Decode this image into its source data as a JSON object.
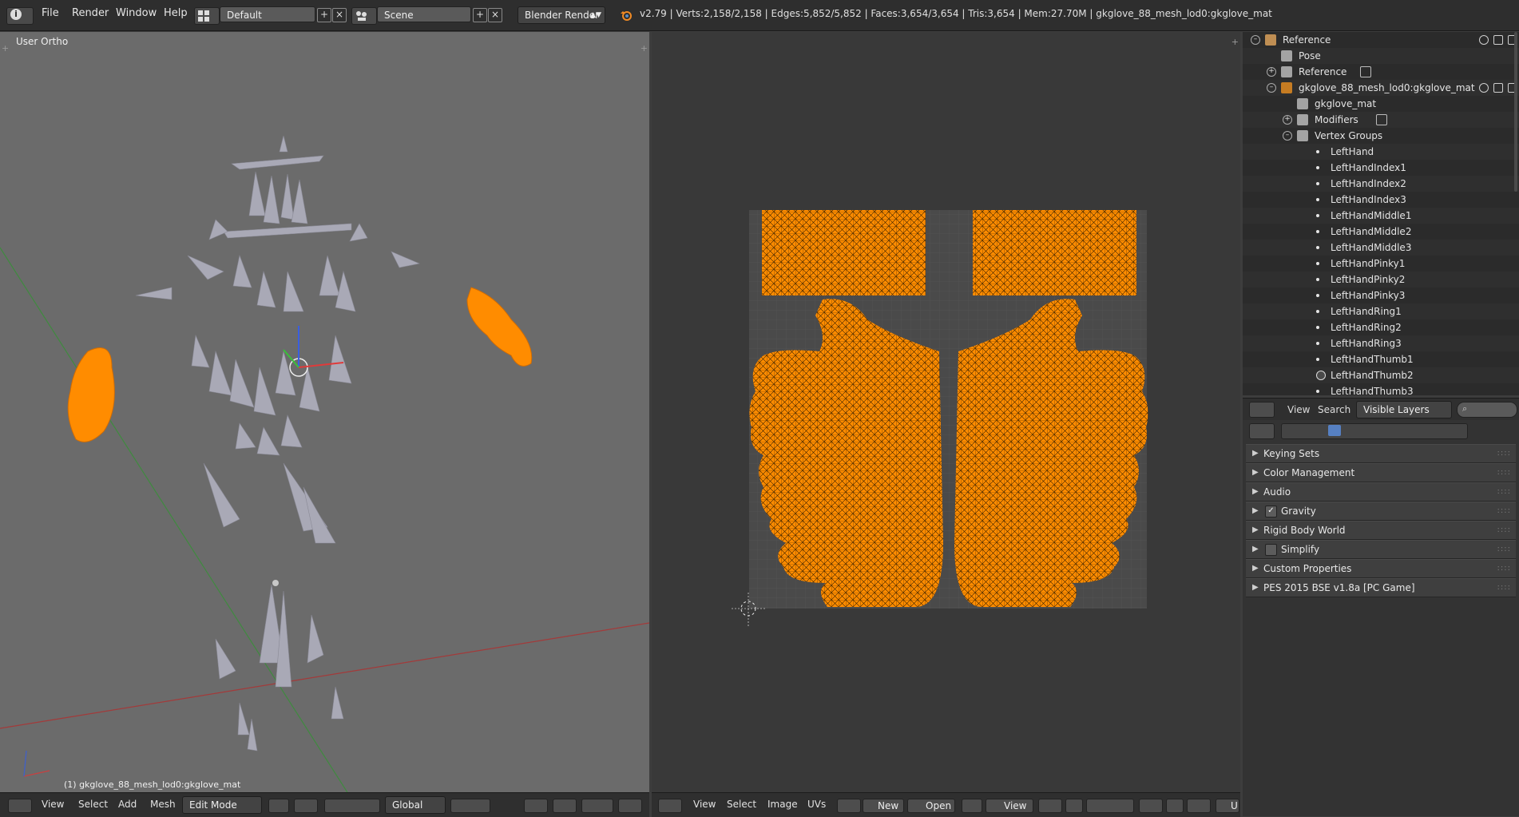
{
  "topbar": {
    "menus": [
      "File",
      "Render",
      "Window",
      "Help"
    ],
    "layout": "Default",
    "scene": "Scene",
    "engine": "Blender Render",
    "stats": "v2.79 | Verts:2,158/2,158 | Edges:5,852/5,852 | Faces:3,654/3,654 | Tris:3,654 | Mem:27.70M | gkglove_88_mesh_lod0:gkglove_mat"
  },
  "view3d": {
    "label": "User Ortho",
    "object_label": "(1) gkglove_88_mesh_lod0:gkglove_mat",
    "footer": {
      "menus": [
        "View",
        "Select",
        "Add",
        "Mesh"
      ],
      "mode": "Edit Mode",
      "orientation": "Global"
    },
    "colors": {
      "background": "#6b6b6b",
      "mesh_selected": "#ff8c00",
      "bones": "#a8a8b4"
    }
  },
  "uv_editor": {
    "footer": {
      "menus": [
        "View",
        "Select",
        "Image",
        "UVs"
      ],
      "new_label": "New",
      "open_label": "Open",
      "view_label": "View",
      "truncated": "U"
    },
    "colors": {
      "background": "#393939",
      "uv_fill": "#ff8c00",
      "grid": "#4a4a4a"
    }
  },
  "outliner": {
    "rows": [
      {
        "label": "Reference",
        "indent": 0,
        "icon": "armature-icon",
        "expand": "minus",
        "vis": true
      },
      {
        "label": "Pose",
        "indent": 1,
        "icon": "pose-icon",
        "expand": "",
        "vis": false
      },
      {
        "label": "Reference",
        "indent": 1,
        "icon": "armature-data-icon",
        "expand": "plus",
        "vis": false,
        "extra": "bone-icon"
      },
      {
        "label": "gkglove_88_mesh_lod0:gkglove_mat",
        "indent": 1,
        "icon": "mesh-object-icon",
        "expand": "minus",
        "vis": true
      },
      {
        "label": "gkglove_mat",
        "indent": 2,
        "icon": "mesh-data-icon",
        "expand": "",
        "vis": false
      },
      {
        "label": "Modifiers",
        "indent": 2,
        "icon": "wrench-icon",
        "expand": "plus",
        "vis": false,
        "extra": "armature-mod-icon"
      },
      {
        "label": "Vertex Groups",
        "indent": 2,
        "icon": "vertex-group-icon",
        "expand": "minus",
        "vis": false
      },
      {
        "label": "LeftHand",
        "indent": 3,
        "icon": "dot-icon",
        "expand": "",
        "vis": false
      },
      {
        "label": "LeftHandIndex1",
        "indent": 3,
        "icon": "dot-icon",
        "expand": "",
        "vis": false
      },
      {
        "label": "LeftHandIndex2",
        "indent": 3,
        "icon": "dot-icon",
        "expand": "",
        "vis": false
      },
      {
        "label": "LeftHandIndex3",
        "indent": 3,
        "icon": "dot-icon",
        "expand": "",
        "vis": false
      },
      {
        "label": "LeftHandMiddle1",
        "indent": 3,
        "icon": "dot-icon",
        "expand": "",
        "vis": false
      },
      {
        "label": "LeftHandMiddle2",
        "indent": 3,
        "icon": "dot-icon",
        "expand": "",
        "vis": false
      },
      {
        "label": "LeftHandMiddle3",
        "indent": 3,
        "icon": "dot-icon",
        "expand": "",
        "vis": false
      },
      {
        "label": "LeftHandPinky1",
        "indent": 3,
        "icon": "dot-icon",
        "expand": "",
        "vis": false
      },
      {
        "label": "LeftHandPinky2",
        "indent": 3,
        "icon": "dot-icon",
        "expand": "",
        "vis": false
      },
      {
        "label": "LeftHandPinky3",
        "indent": 3,
        "icon": "dot-icon",
        "expand": "",
        "vis": false
      },
      {
        "label": "LeftHandRing1",
        "indent": 3,
        "icon": "dot-icon",
        "expand": "",
        "vis": false
      },
      {
        "label": "LeftHandRing2",
        "indent": 3,
        "icon": "dot-icon",
        "expand": "",
        "vis": false
      },
      {
        "label": "LeftHandRing3",
        "indent": 3,
        "icon": "dot-icon",
        "expand": "",
        "vis": false
      },
      {
        "label": "LeftHandThumb1",
        "indent": 3,
        "icon": "dot-icon",
        "expand": "",
        "vis": false
      },
      {
        "label": "LeftHandThumb2",
        "indent": 3,
        "icon": "active-dot-icon",
        "expand": "",
        "vis": false
      },
      {
        "label": "LeftHandThumb3",
        "indent": 3,
        "icon": "dot-icon",
        "expand": "",
        "vis": false
      }
    ],
    "footer": {
      "view": "View",
      "search": "Search",
      "filter": "Visible Layers"
    }
  },
  "properties": {
    "panels": [
      {
        "label": "Keying Sets",
        "checkbox": null
      },
      {
        "label": "Color Management",
        "checkbox": null
      },
      {
        "label": "Audio",
        "checkbox": null
      },
      {
        "label": "Gravity",
        "checkbox": true
      },
      {
        "label": "Rigid Body World",
        "checkbox": null
      },
      {
        "label": "Simplify",
        "checkbox": false
      },
      {
        "label": "Custom Properties",
        "checkbox": null
      },
      {
        "label": "PES 2015 BSE v1.8a [PC Game]",
        "checkbox": null
      }
    ]
  }
}
